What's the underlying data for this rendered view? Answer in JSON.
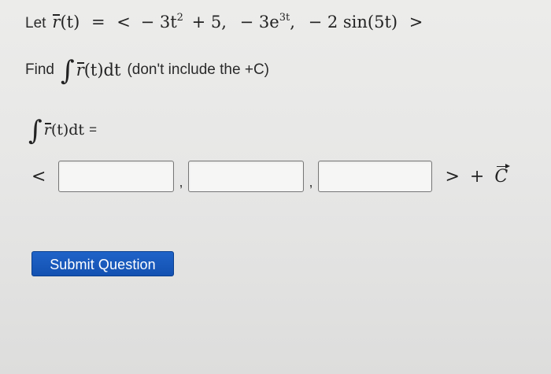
{
  "question": {
    "let_label": "Let",
    "vector_symbol": "r",
    "arg": "(t)",
    "equals": "=",
    "open_bracket": "<",
    "comp1_coef": "− 3t",
    "comp1_exp": "2",
    "comp1_rest": "+ 5,",
    "comp2_coef": "− 3e",
    "comp2_exp": "3t",
    "comp2_comma": ",",
    "comp3": "− 2 sin(5t)",
    "close_bracket": ">",
    "find_label": "Find",
    "integral_sign": "∫",
    "integrand_arg": "(t)dt",
    "note": "(don't include the +C)"
  },
  "answer": {
    "integral_sign": "∫",
    "vector_symbol": "r",
    "arg": "(t)dt",
    "equals": "=",
    "open_bracket": "<",
    "fields": [
      {
        "value": "",
        "placeholder": ""
      },
      {
        "value": "",
        "placeholder": ""
      },
      {
        "value": "",
        "placeholder": ""
      }
    ],
    "separator": ",",
    "close_bracket": ">",
    "plus": "+",
    "constant_symbol": "C"
  },
  "submit": {
    "label": "Submit Question",
    "color": "#1a5bbf"
  }
}
